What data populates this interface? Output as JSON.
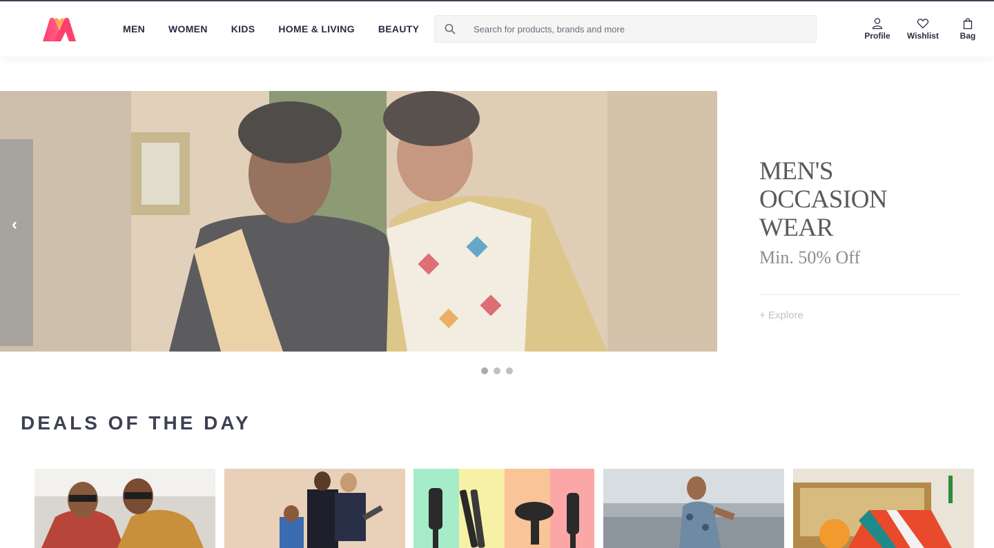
{
  "header": {
    "logo_icon": "myntra-logo-icon",
    "nav": [
      {
        "label": "MEN"
      },
      {
        "label": "WOMEN"
      },
      {
        "label": "KIDS"
      },
      {
        "label": "HOME & LIVING"
      },
      {
        "label": "BEAUTY"
      }
    ],
    "search": {
      "placeholder": "Search for products, brands and more",
      "icon": "search-icon"
    },
    "actions": {
      "profile": {
        "label": "Profile",
        "icon": "user-icon"
      },
      "wishlist": {
        "label": "Wishlist",
        "icon": "heart-icon"
      },
      "bag": {
        "label": "Bag",
        "icon": "bag-icon"
      }
    }
  },
  "hero": {
    "prev_icon": "chevron-left-icon",
    "title_line1": "MEN'S",
    "title_line2": "OCCASION WEAR",
    "subtitle": "Min. 50% Off",
    "explore_label": "+ Explore",
    "dots_count": 3,
    "active_dot": 0
  },
  "deals": {
    "title": "DEALS OF THE DAY",
    "items": [
      {
        "name": "deal-men-shirts"
      },
      {
        "name": "deal-kids-wear"
      },
      {
        "name": "deal-hair-appliances"
      },
      {
        "name": "deal-men-tshirt"
      },
      {
        "name": "deal-home-decor"
      }
    ]
  },
  "colors": {
    "brand_pink": "#ff3f6c",
    "brand_orange": "#ff905a",
    "text_dark": "#282c3f",
    "heading": "#3e4152"
  }
}
